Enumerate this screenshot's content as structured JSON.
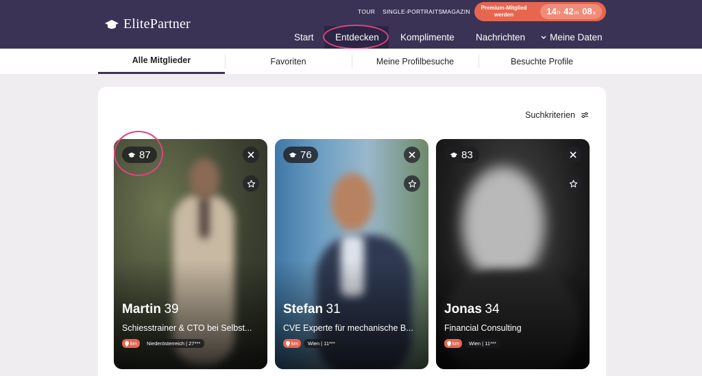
{
  "brand": {
    "logo_text": "ElitePartner"
  },
  "util_links": [
    "TOUR",
    "SINGLE-PORTRAITS",
    "MAGAZIN"
  ],
  "premium": {
    "label": "Premium-Mitglied werden",
    "timer": {
      "hours": "14",
      "h_unit": "h",
      "minutes": "42",
      "m_unit": "m",
      "seconds": "08",
      "s_unit": "s"
    }
  },
  "nav": {
    "items": [
      "Start",
      "Entdecken",
      "Komplimente",
      "Nachrichten",
      "Meine Daten"
    ],
    "active": "Entdecken"
  },
  "subtabs": {
    "items": [
      "Alle Mitglieder",
      "Favoriten",
      "Meine Profilbesuche",
      "Besuchte Profile"
    ],
    "active": "Alle Mitglieder"
  },
  "search": {
    "criteria_label": "Suchkriterien"
  },
  "profiles": [
    {
      "score": "87",
      "name": "Martin",
      "age": "39",
      "job": "Schiesstrainer & CTO bei Selbst...",
      "km_label": "km",
      "location": "Niederösterreich | 27***"
    },
    {
      "score": "76",
      "name": "Stefan",
      "age": "31",
      "job": "CVE Experte für mechanische B...",
      "km_label": "km",
      "location": "Wien | 11***"
    },
    {
      "score": "83",
      "name": "Jonas",
      "age": "34",
      "job": "Financial Consulting",
      "km_label": "km",
      "location": "Wien | 11***"
    }
  ],
  "colors": {
    "header": "#3a3356",
    "accent": "#e8654f",
    "highlight_ring": "#e0447f"
  },
  "icons": [
    "graduation-cap-icon",
    "close-icon",
    "star-icon",
    "location-pin-icon",
    "filter-sliders-icon",
    "chevron-down-icon"
  ]
}
